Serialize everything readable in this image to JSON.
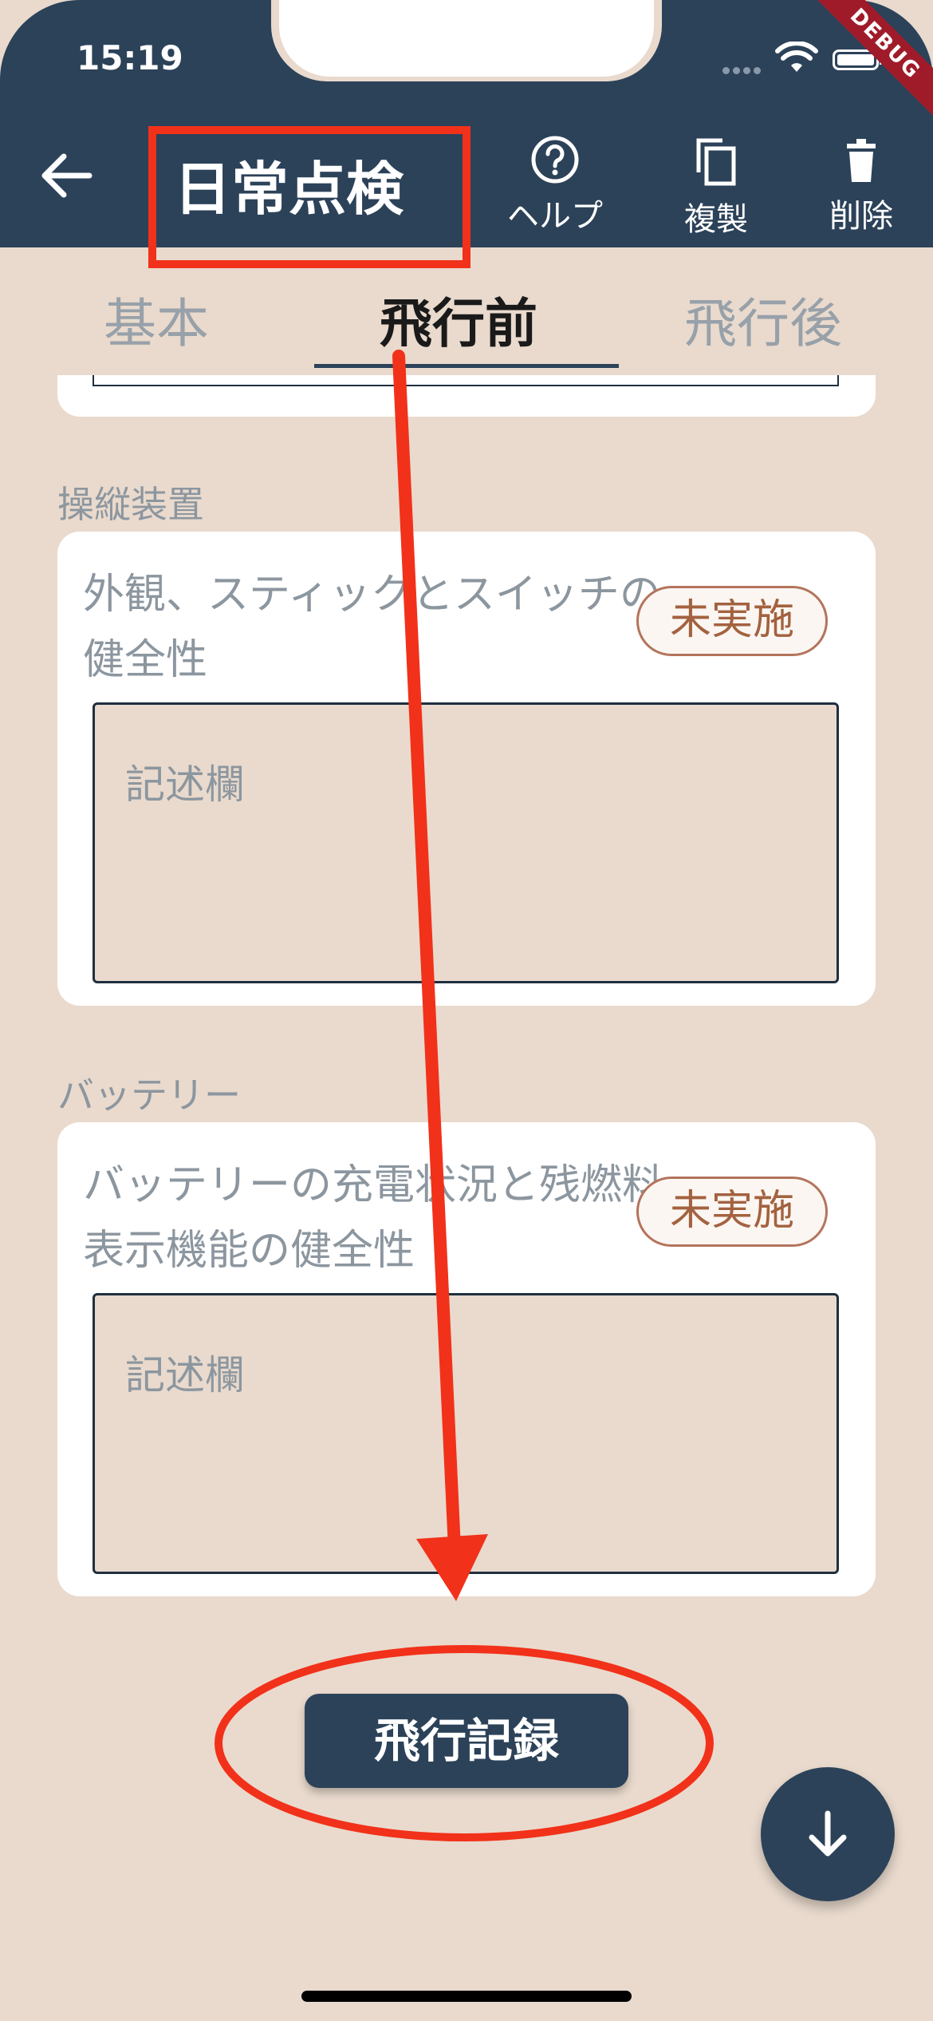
{
  "status_bar": {
    "time": "15:19",
    "debug_label": "DEBUG"
  },
  "header": {
    "title": "日常点検",
    "actions": [
      {
        "label": "ヘルプ",
        "icon": "help-circle-icon"
      },
      {
        "label": "複製",
        "icon": "copy-icon"
      },
      {
        "label": "削除",
        "icon": "trash-icon"
      }
    ]
  },
  "tabs": [
    {
      "label": "基本",
      "active": false
    },
    {
      "label": "飛行前",
      "active": true
    },
    {
      "label": "飛行後",
      "active": false
    }
  ],
  "sections": [
    {
      "heading": "操縦装置",
      "item": {
        "title": "外観、スティックとスイッチの健全性",
        "status": "未実施",
        "memo_placeholder": "記述欄"
      }
    },
    {
      "heading": "バッテリー",
      "item": {
        "title": "バッテリーの充電状況と残燃料表示機能の健全性",
        "status": "未実施",
        "memo_placeholder": "記述欄"
      }
    }
  ],
  "flight_log_button": "飛行記録",
  "colors": {
    "primary": "#2c4259",
    "background": "#e9dacd",
    "chip_text": "#a3623f",
    "annotation": "#f2311a"
  }
}
